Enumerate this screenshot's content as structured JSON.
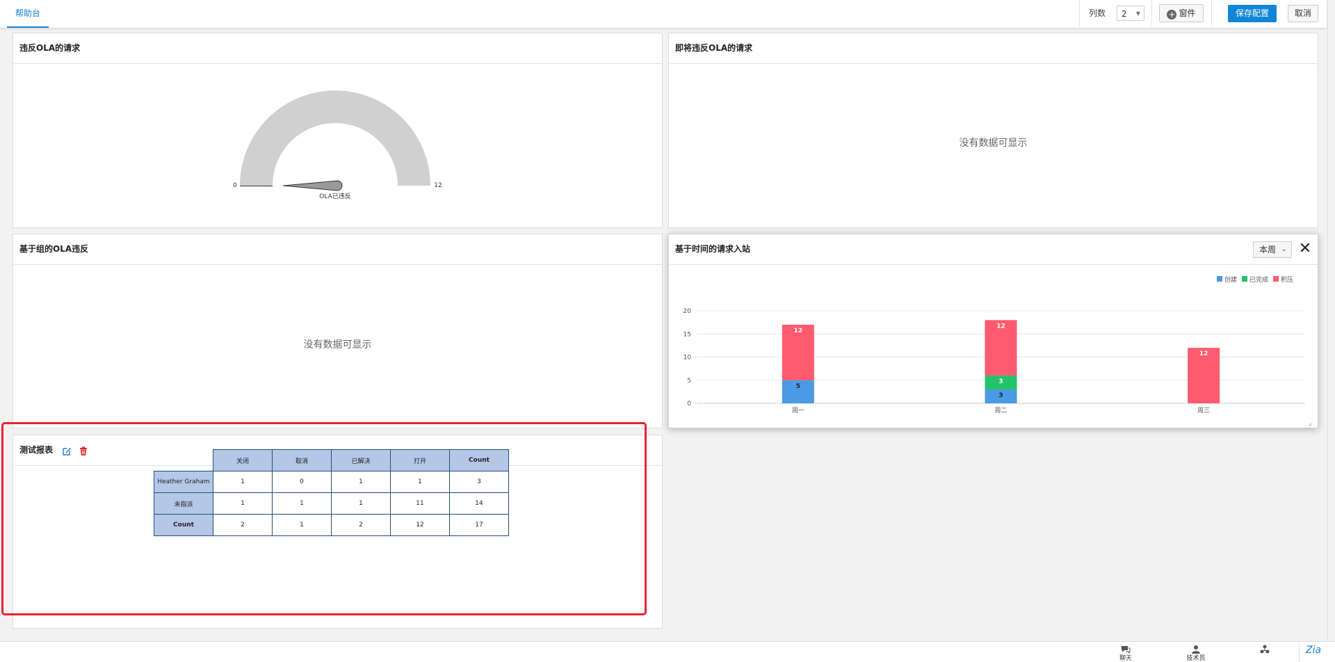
{
  "header": {
    "active_tab": "帮助台",
    "columns_label": "列数",
    "columns_value": "2",
    "add_widget_label": "窗件",
    "save_label": "保存配置",
    "cancel_label": "取消"
  },
  "panels": {
    "ola_violated": {
      "title": "违反OLA的请求",
      "gauge": {
        "min": "0",
        "max": "12",
        "value": 0,
        "label": "OLA已违反"
      }
    },
    "ola_upcoming": {
      "title": "即将违反OLA的请求",
      "empty_text": "没有数据可显示"
    },
    "group_ola": {
      "title": "基于组的OLA违反",
      "empty_text": "没有数据可显示"
    },
    "time_requests": {
      "title": "基于时间的请求入站",
      "period": "本周",
      "legend": [
        "创建",
        "已完成",
        "积压"
      ]
    },
    "test_report": {
      "title": "测试报表",
      "columns": [
        "关闭",
        "取消",
        "已解决",
        "打开",
        "Count"
      ],
      "rows": [
        {
          "label": "Heather Graham",
          "cells": [
            "1",
            "0",
            "1",
            "1",
            "3"
          ]
        },
        {
          "label": "未指派",
          "cells": [
            "1",
            "1",
            "1",
            "11",
            "14"
          ]
        },
        {
          "label": "Count",
          "cells": [
            "2",
            "1",
            "2",
            "12",
            "17"
          ]
        }
      ]
    }
  },
  "chart_data": {
    "type": "bar",
    "stacked": true,
    "categories": [
      "周一",
      "周二",
      "周三"
    ],
    "series": [
      {
        "name": "创建",
        "color": "#4a9ae6",
        "values": [
          5,
          3,
          0
        ]
      },
      {
        "name": "已完成",
        "color": "#23c36a",
        "values": [
          0,
          3,
          0
        ]
      },
      {
        "name": "积压",
        "color": "#ff5b6e",
        "values": [
          12,
          12,
          12
        ]
      }
    ],
    "ylim": [
      0,
      20
    ],
    "yticks": [
      "0",
      "5",
      "10",
      "15",
      "20"
    ],
    "legend_position": "top-right",
    "grid": true
  },
  "statusbar": {
    "chat_label": "聊天",
    "tech_label": "技术员",
    "zia_label": "Zia"
  }
}
